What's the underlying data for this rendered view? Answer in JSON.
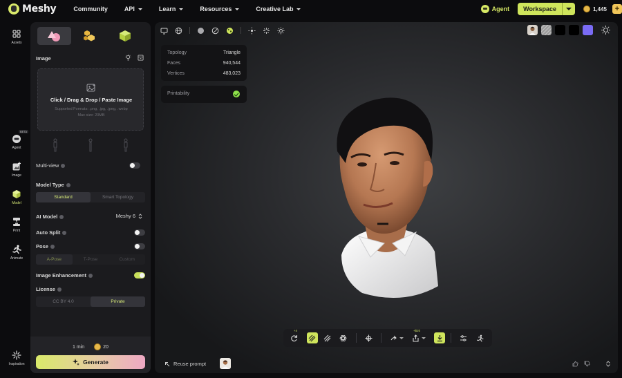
{
  "brand": {
    "name": "Meshy"
  },
  "nav": {
    "links": [
      {
        "label": "Community",
        "has_caret": false
      },
      {
        "label": "API",
        "has_caret": true
      },
      {
        "label": "Learn",
        "has_caret": true
      },
      {
        "label": "Resources",
        "has_caret": true
      },
      {
        "label": "Creative Lab",
        "has_caret": true
      }
    ],
    "agent_label": "Agent",
    "workspace_label": "Workspace",
    "credits": "1,445",
    "plus": "+"
  },
  "rail": {
    "assets": "Assets",
    "agent": "Agent",
    "agent_badge": "BETA",
    "image": "Image",
    "model": "Model",
    "print": "Print",
    "animate": "Animate",
    "inspiration": "Inspiration"
  },
  "panel": {
    "image_section": "Image",
    "upload_title": "Click / Drag & Drop / Paste Image",
    "upload_formats": "Supported Formats: .png, .jpg, .jpeg, .webp",
    "upload_max": "Max size: 20MB",
    "multiview_label": "Multi-view",
    "model_type_label": "Model Type",
    "model_type_options": [
      "Standard",
      "Smart Topology"
    ],
    "model_type_selected": 0,
    "ai_model_label": "AI Model",
    "ai_model_value": "Meshy 6",
    "auto_split_label": "Auto Split",
    "pose_label": "Pose",
    "pose_options": [
      "A-Pose",
      "T-Pose",
      "Custom"
    ],
    "pose_selected": 0,
    "image_enhancement_label": "Image Enhancement",
    "image_enhancement_on": true,
    "license_label": "License",
    "license_options": [
      "CC BY 4.0",
      "Private"
    ],
    "license_selected": 1,
    "time": "1 min",
    "cost": "20",
    "generate_label": "Generate"
  },
  "viewport": {
    "stats": [
      {
        "label": "Topology",
        "value": "Triangle"
      },
      {
        "label": "Faces",
        "value": "940,544"
      },
      {
        "label": "Vertices",
        "value": "483,023"
      }
    ],
    "printability_label": "Printability",
    "swatch_colors": [
      "#000000",
      "#000000",
      "#7a6bf4"
    ],
    "remesh_badge": "+4",
    "export_cost": "+$20",
    "reuse_prompt": "Reuse prompt"
  },
  "colors": {
    "accent": "#cfe55c",
    "panel": "#1b1b1e",
    "bg": "#0c0c0e"
  }
}
